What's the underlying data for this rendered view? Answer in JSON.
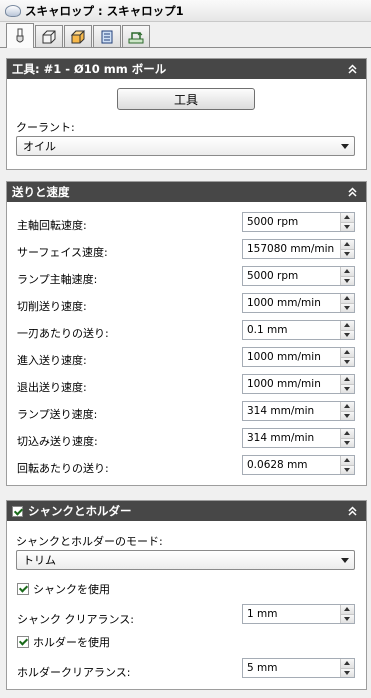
{
  "window": {
    "title": "スキャロップ : スキャロップ1"
  },
  "tabs": [
    {
      "name": "tool-tab",
      "icon": "tool-icon",
      "active": true
    },
    {
      "name": "geometry-tab",
      "icon": "geometry-box-icon",
      "active": false
    },
    {
      "name": "heights-tab",
      "icon": "heights-box-icon",
      "active": false
    },
    {
      "name": "passes-tab",
      "icon": "passes-icon",
      "active": false
    },
    {
      "name": "linking-tab",
      "icon": "linking-icon",
      "active": false
    }
  ],
  "tool_panel": {
    "header": "工具: #1 - Ø10 mm ボール",
    "tool_button": "工具",
    "coolant_label": "クーラント:",
    "coolant_value": "オイル"
  },
  "feeds_panel": {
    "header": "送りと速度",
    "rows": [
      {
        "label": "主軸回転速度:",
        "value": "5000 rpm"
      },
      {
        "label": "サーフェイス速度:",
        "value": "157080 mm/min"
      },
      {
        "label": "ランプ主軸速度:",
        "value": "5000 rpm"
      },
      {
        "label": "切削送り速度:",
        "value": "1000 mm/min"
      },
      {
        "label": "一刃あたりの送り:",
        "value": "0.1 mm"
      },
      {
        "label": "進入送り速度:",
        "value": "1000 mm/min"
      },
      {
        "label": "退出送り速度:",
        "value": "1000 mm/min"
      },
      {
        "label": "ランプ送り速度:",
        "value": "314 mm/min"
      },
      {
        "label": "切込み送り速度:",
        "value": "314 mm/min"
      },
      {
        "label": "回転あたりの送り:",
        "value": "0.0628 mm"
      }
    ]
  },
  "shank_panel": {
    "header": "シャンクとホルダー",
    "header_checked": true,
    "mode_label": "シャンクとホルダーのモード:",
    "mode_value": "トリム",
    "use_shank_label": "シャンクを使用",
    "use_shank_checked": true,
    "shank_clearance_label": "シャンク クリアランス:",
    "shank_clearance_value": "1 mm",
    "use_holder_label": "ホルダーを使用",
    "use_holder_checked": true,
    "holder_clearance_label": "ホルダークリアランス:",
    "holder_clearance_value": "5 mm"
  },
  "colors": {
    "panel_header": "#474747",
    "background": "#f0f0f0",
    "check": "#1a6a1a"
  }
}
